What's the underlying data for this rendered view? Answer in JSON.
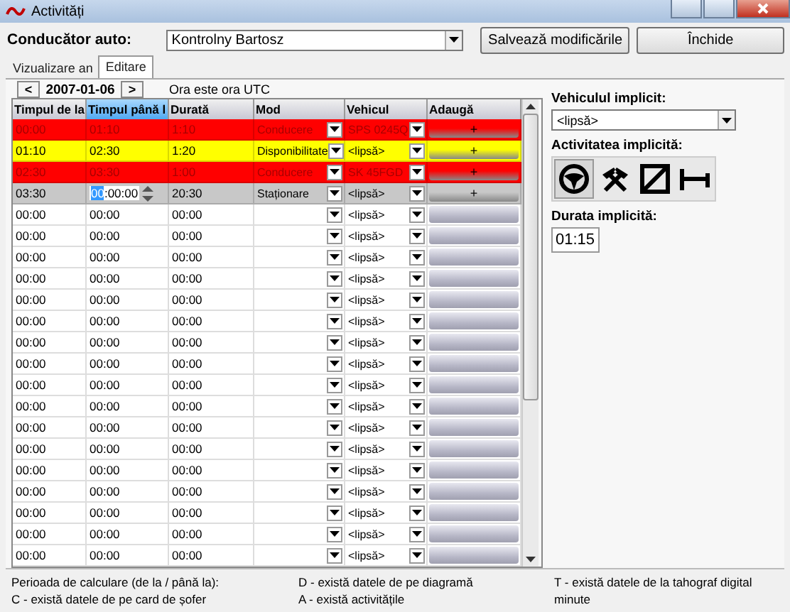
{
  "window": {
    "title": "Activități"
  },
  "driver": {
    "label": "Conducător auto:",
    "value": "Kontrolny Bartosz"
  },
  "buttons": [
    {
      "label": "Salvează modificările",
      "kind": "save"
    },
    {
      "label": "Închide",
      "kind": "close"
    }
  ],
  "tabs": [
    {
      "label": "Vizualizare an",
      "selected": false
    },
    {
      "label": "Editare",
      "selected": true
    }
  ],
  "date_nav": {
    "prev": "<",
    "date": "2007-01-06",
    "next": ">",
    "note": "Ora este ora UTC"
  },
  "table": {
    "columns": [
      {
        "label": "Timpul de la",
        "selected": false
      },
      {
        "label": "Timpul până l",
        "selected": true
      },
      {
        "label": "Durată",
        "selected": false
      },
      {
        "label": "Mod",
        "selected": false
      },
      {
        "label": "Vehicul",
        "selected": false
      },
      {
        "label": "Adaugă",
        "selected": false
      }
    ],
    "rows": [
      {
        "from": "00:00",
        "to": "01:10",
        "duration": "1:10",
        "mode": "Conducere",
        "vehicle": "SPS 0245Q",
        "add": "+",
        "color": "#ff0000",
        "kind": "normal"
      },
      {
        "from": "01:10",
        "to": "02:30",
        "duration": "1:20",
        "mode": "Disponibilitate",
        "vehicle": "<lipsă>",
        "add": "+",
        "color": "#ffff00",
        "kind": "normal"
      },
      {
        "from": "02:30",
        "to": "03:30",
        "duration": "1:00",
        "mode": "Conducere",
        "vehicle": "SK 45FGD",
        "add": "+",
        "color": "#ff0000",
        "kind": "normal"
      },
      {
        "from": "03:30",
        "to": "00:00:00",
        "duration": "20:30",
        "mode": "Staționare",
        "vehicle": "<lipsă>",
        "add": "+",
        "color": "#c8c8c8",
        "kind": "editing"
      },
      {
        "from": "00:00",
        "to": "00:00",
        "duration": "00:00",
        "vehicle": "<lipsă>",
        "kind": "normal"
      },
      {
        "from": "00:00",
        "to": "00:00",
        "duration": "00:00",
        "vehicle": "<lipsă>",
        "kind": "normal"
      },
      {
        "from": "00:00",
        "to": "00:00",
        "duration": "00:00",
        "vehicle": "<lipsă>",
        "kind": "normal"
      },
      {
        "from": "00:00",
        "to": "00:00",
        "duration": "00:00",
        "vehicle": "<lipsă>",
        "kind": "normal"
      },
      {
        "from": "00:00",
        "to": "00:00",
        "duration": "00:00",
        "vehicle": "<lipsă>",
        "kind": "normal"
      },
      {
        "from": "00:00",
        "to": "00:00",
        "duration": "00:00",
        "vehicle": "<lipsă>",
        "kind": "normal"
      },
      {
        "from": "00:00",
        "to": "00:00",
        "duration": "00:00",
        "vehicle": "<lipsă>",
        "kind": "normal"
      },
      {
        "from": "00:00",
        "to": "00:00",
        "duration": "00:00",
        "vehicle": "<lipsă>",
        "kind": "normal"
      },
      {
        "from": "00:00",
        "to": "00:00",
        "duration": "00:00",
        "vehicle": "<lipsă>",
        "kind": "normal"
      },
      {
        "from": "00:00",
        "to": "00:00",
        "duration": "00:00",
        "vehicle": "<lipsă>",
        "kind": "normal"
      },
      {
        "from": "00:00",
        "to": "00:00",
        "duration": "00:00",
        "vehicle": "<lipsă>",
        "kind": "normal"
      },
      {
        "from": "00:00",
        "to": "00:00",
        "duration": "00:00",
        "vehicle": "<lipsă>",
        "kind": "normal"
      },
      {
        "from": "00:00",
        "to": "00:00",
        "duration": "00:00",
        "vehicle": "<lipsă>",
        "kind": "normal"
      },
      {
        "from": "00:00",
        "to": "00:00",
        "duration": "00:00",
        "vehicle": "<lipsă>",
        "kind": "normal"
      },
      {
        "from": "00:00",
        "to": "00:00",
        "duration": "00:00",
        "vehicle": "<lipsă>",
        "kind": "normal"
      },
      {
        "from": "00:00",
        "to": "00:00",
        "duration": "00:00",
        "vehicle": "<lipsă>",
        "kind": "normal"
      },
      {
        "from": "00:00",
        "to": "00:00",
        "duration": "00:00",
        "vehicle": "<lipsă>",
        "kind": "normal"
      }
    ]
  },
  "defaults": {
    "vehicle_label": "Vehiculul implicit:",
    "vehicle": "<lipsă>",
    "activity_label": "Activitatea implicită:",
    "activities": [
      {
        "kind": "driving",
        "selected": true
      },
      {
        "kind": "work",
        "selected": false
      },
      {
        "kind": "availability",
        "selected": false
      },
      {
        "kind": "rest",
        "selected": false
      }
    ],
    "duration_label": "Durata implicită:",
    "duration": "01:15"
  },
  "legend": [
    "Perioada de calculare (de la / până la):",
    "D - există datele de pe diagramă",
    "T - există datele de la tahograf digital",
    "C - există datele de pe card de șofer",
    "A - există activitățile",
    "minute"
  ]
}
